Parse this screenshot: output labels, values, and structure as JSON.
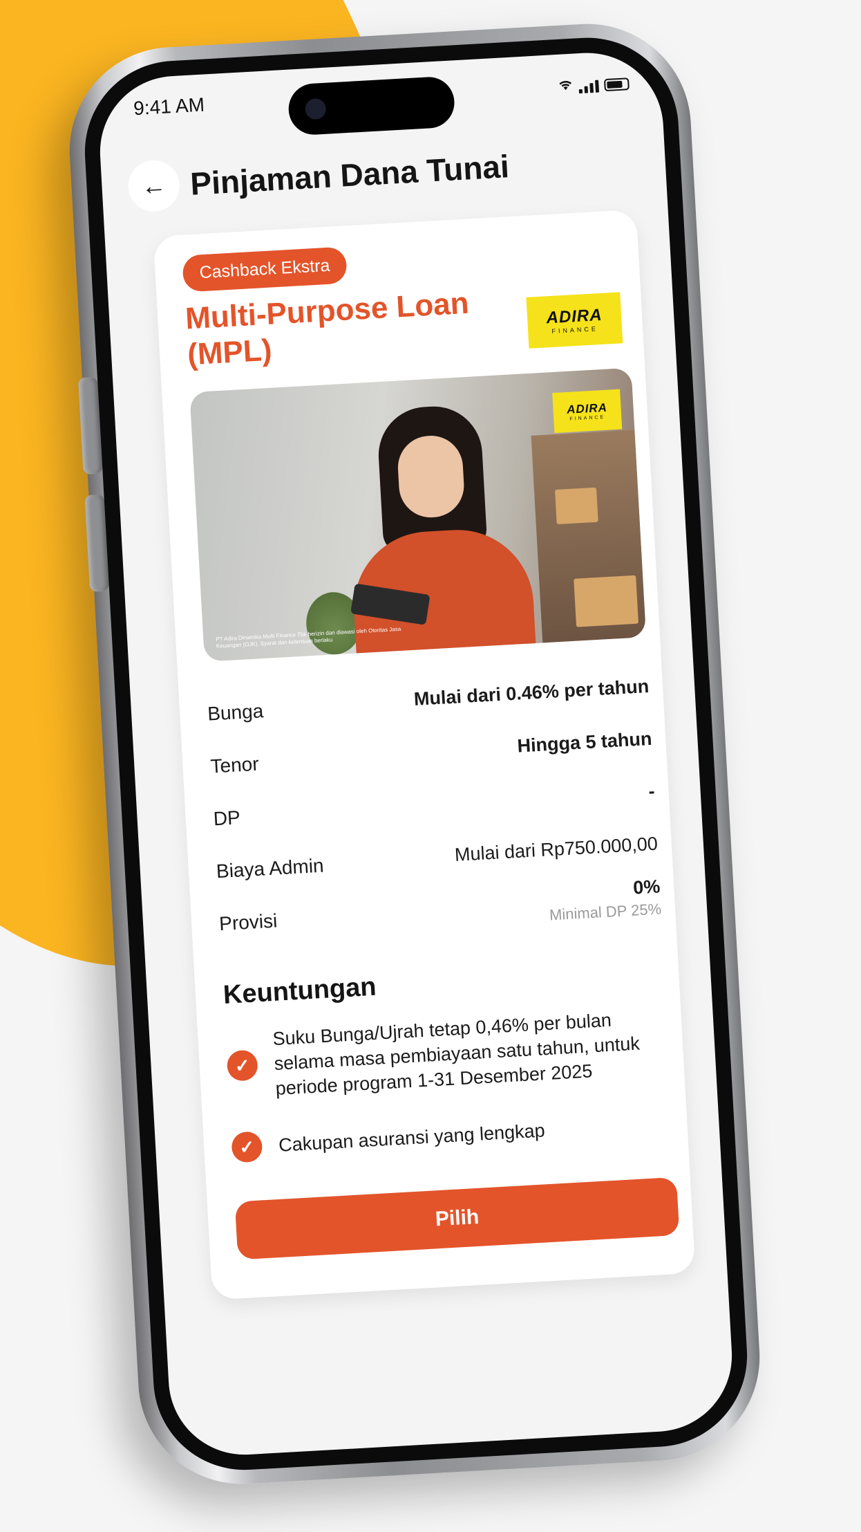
{
  "status_bar": {
    "time": "9:41 AM"
  },
  "header": {
    "back_icon": "arrow-left-icon",
    "title": "Pinjaman Dana Tunai"
  },
  "product": {
    "badge": "Cashback Ekstra",
    "title": "Multi-Purpose Loan (MPL)",
    "logo": {
      "word": "ADIRA",
      "sub": "FINANCE"
    },
    "banner": {
      "logo_word": "ADIRA",
      "logo_sub": "FINANCE",
      "disclaimer": "PT Adira Dinamika Multi Finance Tbk berizin dan diawasi oleh Otoritas Jasa Keuangan (OJK). Syarat dan ketentuan berlaku"
    }
  },
  "specs": [
    {
      "label": "Bunga",
      "value": "Mulai dari 0.46% per tahun",
      "note": ""
    },
    {
      "label": "Tenor",
      "value": "Hingga 5 tahun",
      "note": ""
    },
    {
      "label": "DP",
      "value": "-",
      "note": ""
    },
    {
      "label": "Biaya Admin",
      "value": "Mulai dari Rp750.000,00",
      "note": ""
    },
    {
      "label": "Provisi",
      "value": "0%",
      "note": "Minimal DP 25%"
    }
  ],
  "benefits": {
    "title": "Keuntungan",
    "items": [
      "Suku Bunga/Ujrah tetap 0,46% per bulan selama masa pembiayaan satu tahun, untuk periode program 1-31 Desember 2025",
      "Cakupan asuransi yang lengkap"
    ]
  },
  "actions": {
    "choose_label": "Pilih"
  },
  "colors": {
    "accent": "#e3542a",
    "background_blob": "#fbb521",
    "logo_yellow": "#f5e21a"
  }
}
